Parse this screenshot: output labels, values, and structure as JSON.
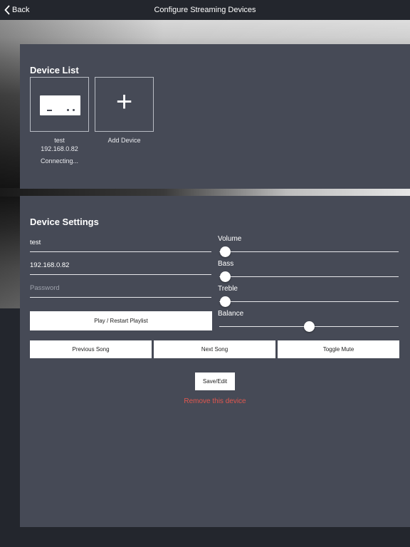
{
  "nav": {
    "back_label": "Back",
    "title": "Configure Streaming Devices"
  },
  "device_list": {
    "title": "Device List",
    "devices": [
      {
        "name": "test",
        "ip": "192.168.0.82",
        "status": "Connecting..."
      }
    ],
    "add_label": "Add Device"
  },
  "settings": {
    "title": "Device Settings",
    "name_value": "test",
    "ip_value": "192.168.0.82",
    "password_placeholder": "Password",
    "play_label": "Play / Restart Playlist",
    "prev_label": "Previous Song",
    "next_label": "Next Song",
    "mute_label": "Toggle Mute",
    "save_label": "Save/Edit",
    "remove_label": "Remove this device",
    "sliders": [
      {
        "label": "Volume",
        "value": 0.0
      },
      {
        "label": "Bass",
        "value": 0.0
      },
      {
        "label": "Treble",
        "value": 0.0
      },
      {
        "label": "Balance",
        "value": 0.5
      }
    ]
  },
  "colors": {
    "panel": "#464a56",
    "background": "#23262d",
    "remove": "#e0574f"
  }
}
